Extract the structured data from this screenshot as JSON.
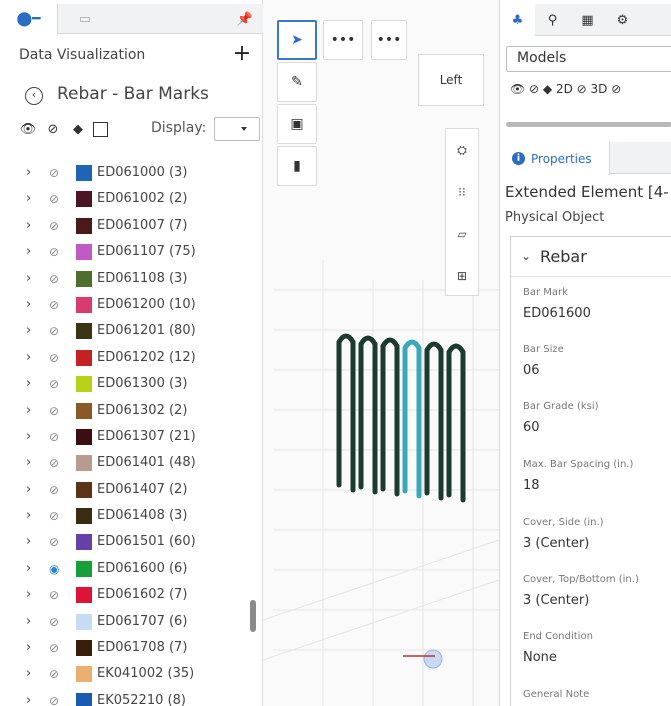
{
  "left_panel": {
    "title": "Data Visualization",
    "add_label": "+",
    "header": "Rebar - Bar Marks",
    "display_label": "Display:",
    "bar_marks": [
      {
        "name": "ED061000 (3)",
        "color": "#1f64b5",
        "visible": false
      },
      {
        "name": "ED061002 (2)",
        "color": "#4a1626",
        "visible": false
      },
      {
        "name": "ED061007 (7)",
        "color": "#4a1a1a",
        "visible": false
      },
      {
        "name": "ED061107 (75)",
        "color": "#c05ac4",
        "visible": false
      },
      {
        "name": "ED061108 (3)",
        "color": "#4d6e2c",
        "visible": false
      },
      {
        "name": "ED061200 (10)",
        "color": "#d83c6c",
        "visible": false
      },
      {
        "name": "ED061201 (80)",
        "color": "#3b3412",
        "visible": false
      },
      {
        "name": "ED061202 (12)",
        "color": "#c42222",
        "visible": false
      },
      {
        "name": "ED061300 (3)",
        "color": "#b8d21a",
        "visible": false
      },
      {
        "name": "ED061302 (2)",
        "color": "#8a5a26",
        "visible": false
      },
      {
        "name": "ED061307 (21)",
        "color": "#3b0e12",
        "visible": false
      },
      {
        "name": "ED061401 (48)",
        "color": "#b89a8e",
        "visible": false
      },
      {
        "name": "ED061407 (2)",
        "color": "#5a3414",
        "visible": false
      },
      {
        "name": "ED061408 (3)",
        "color": "#3a2c10",
        "visible": false
      },
      {
        "name": "ED061501 (60)",
        "color": "#6440a8",
        "visible": false
      },
      {
        "name": "ED061600 (6)",
        "color": "#16a03c",
        "visible": true
      },
      {
        "name": "ED061602 (7)",
        "color": "#dc1438",
        "visible": false
      },
      {
        "name": "ED061707 (6)",
        "color": "#c6dcf2",
        "visible": false
      },
      {
        "name": "ED061708 (7)",
        "color": "#3a1e0c",
        "visible": false
      },
      {
        "name": "EK041002 (35)",
        "color": "#eab070",
        "visible": false
      },
      {
        "name": "EK052210 (8)",
        "color": "#1a5ab0",
        "visible": false
      }
    ]
  },
  "viewport": {
    "view_label": "Left",
    "more_label": "•••"
  },
  "right_panel": {
    "models_value": "Models",
    "view_toggles": "👁 ⊘ ◆  2D ⊘ 3D ⊘",
    "properties_tab": "Properties",
    "element_title": "Extended Element [4-",
    "element_subtitle": "Physical Object",
    "section_title": "Rebar",
    "properties": [
      {
        "key": "Bar Mark",
        "value": "ED061600"
      },
      {
        "key": "Bar Size",
        "value": "06"
      },
      {
        "key": "Bar Grade (ksi)",
        "value": "60"
      },
      {
        "key": "Max. Bar Spacing (in.)",
        "value": "18"
      },
      {
        "key": "Cover, Side (in.)",
        "value": "3 (Center)"
      },
      {
        "key": "Cover, Top/Bottom (in.)",
        "value": "3 (Center)"
      },
      {
        "key": "End Condition",
        "value": "None"
      },
      {
        "key": "General Note",
        "value": ""
      }
    ]
  }
}
